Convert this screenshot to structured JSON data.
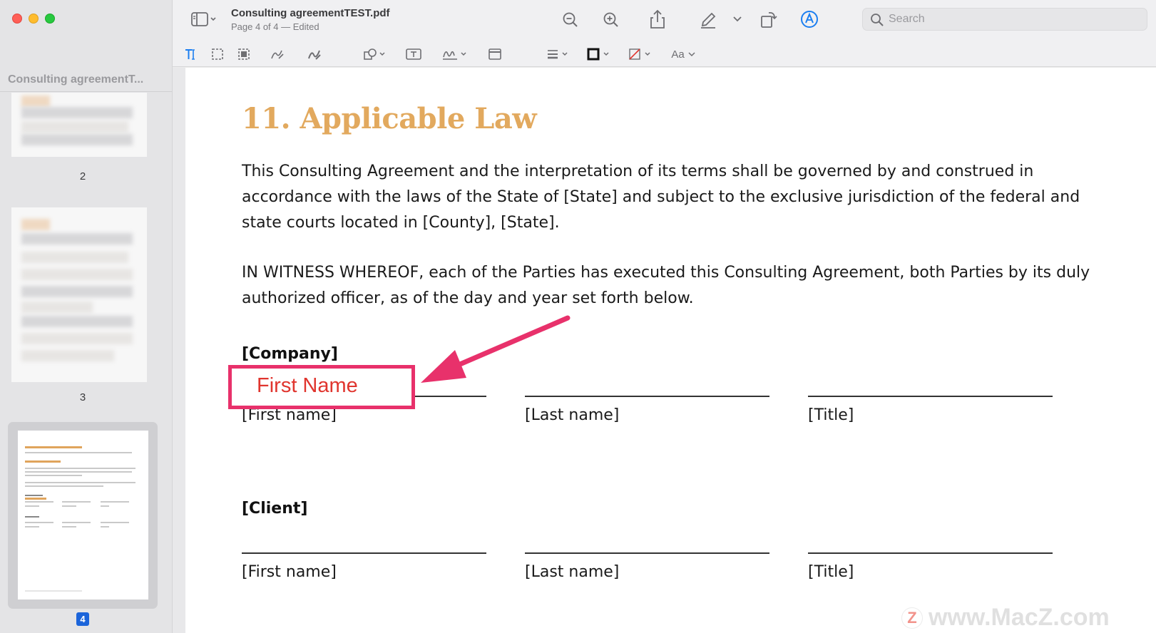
{
  "window": {
    "title": "Consulting agreementTEST.pdf",
    "subtitle": "Page 4 of 4 — Edited"
  },
  "toolbar": {
    "search_placeholder": "Search",
    "markup_text_label": "Aa"
  },
  "sidebar": {
    "title": "Consulting agreementT...",
    "pages": [
      {
        "label": "2"
      },
      {
        "label": "3"
      },
      {
        "label": "4",
        "selected": true
      }
    ]
  },
  "document": {
    "heading": "11. Applicable Law",
    "paragraph1": "This Consulting Agreement and the interpretation of its terms shall be governed by and construed in accordance with the laws of the State of [State] and subject to the exclusive jurisdiction of the federal and state courts located in [County], [State].",
    "paragraph2": "IN WITNESS WHEREOF, each of the Parties has executed this Consulting Agreement, both Parties by its duly authorized officer, as of the day and year set forth below.",
    "company": {
      "label": "[Company]",
      "first_name": "[First name]",
      "last_name": "[Last name]",
      "title": "[Title]"
    },
    "client": {
      "label": "[Client]",
      "first_name": "[First name]",
      "last_name": "[Last name]",
      "title": "[Title]"
    },
    "text_field_value": "First Name"
  },
  "annotation": {
    "highlight_color": "#e8316b",
    "text_color": "#e0352e"
  },
  "watermark": {
    "logo_letter": "Z",
    "text": "www.MacZ.com"
  },
  "colors": {
    "heading": "#e2a95e",
    "accent_blue": "#1b64da"
  }
}
